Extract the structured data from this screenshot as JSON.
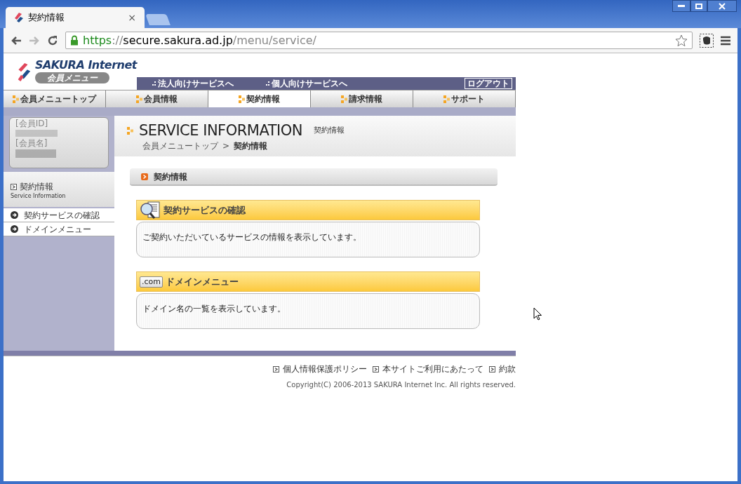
{
  "browser": {
    "tab": {
      "title": "契約情報",
      "close": "×"
    },
    "url": {
      "scheme": "https",
      "sep": "://",
      "host": "secure.sakura.ad.jp",
      "path": "/menu/service/"
    }
  },
  "header": {
    "logo": {
      "name": "SAKURA Internet",
      "subtitle": "会員メニュー"
    },
    "links": [
      "法人向けサービスへ",
      "個人向けサービスへ"
    ],
    "logout": "ログアウト"
  },
  "nav": [
    {
      "label": "会員メニュートップ",
      "selected": false
    },
    {
      "label": "会員情報",
      "selected": false
    },
    {
      "label": "契約情報",
      "selected": true
    },
    {
      "label": "請求情報",
      "selected": false
    },
    {
      "label": "サポート",
      "selected": false
    }
  ],
  "member": {
    "id_label": "[会員ID]",
    "name_label": "[会員名]"
  },
  "sidebar": {
    "title": "契約情報",
    "subtitle": "Service Information",
    "items": [
      "契約サービスの確認",
      "ドメインメニュー"
    ]
  },
  "page": {
    "title": "SERVICE INFORMATION",
    "subtitle": "契約情報",
    "breadcrumb": [
      {
        "label": "会員メニュートップ",
        "current": false
      },
      {
        "label": "契約情報",
        "current": true
      }
    ],
    "breadcrumb_separator": ">"
  },
  "section": "契約情報",
  "cards": [
    {
      "kind": "search",
      "title": "契約サービスの確認",
      "text": "ご契約いただいているサービスの情報を表示しています。"
    },
    {
      "kind": "domain",
      "badge": ".com",
      "title": "ドメインメニュー",
      "text": "ドメイン名の一覧を表示しています。"
    }
  ],
  "footer": {
    "links": [
      "個人情報保護ポリシー",
      "本サイトご利用にあたって",
      "約款"
    ],
    "copyright": "Copyright(C) 2006-2013 SAKURA Internet Inc. All rights reserved."
  }
}
